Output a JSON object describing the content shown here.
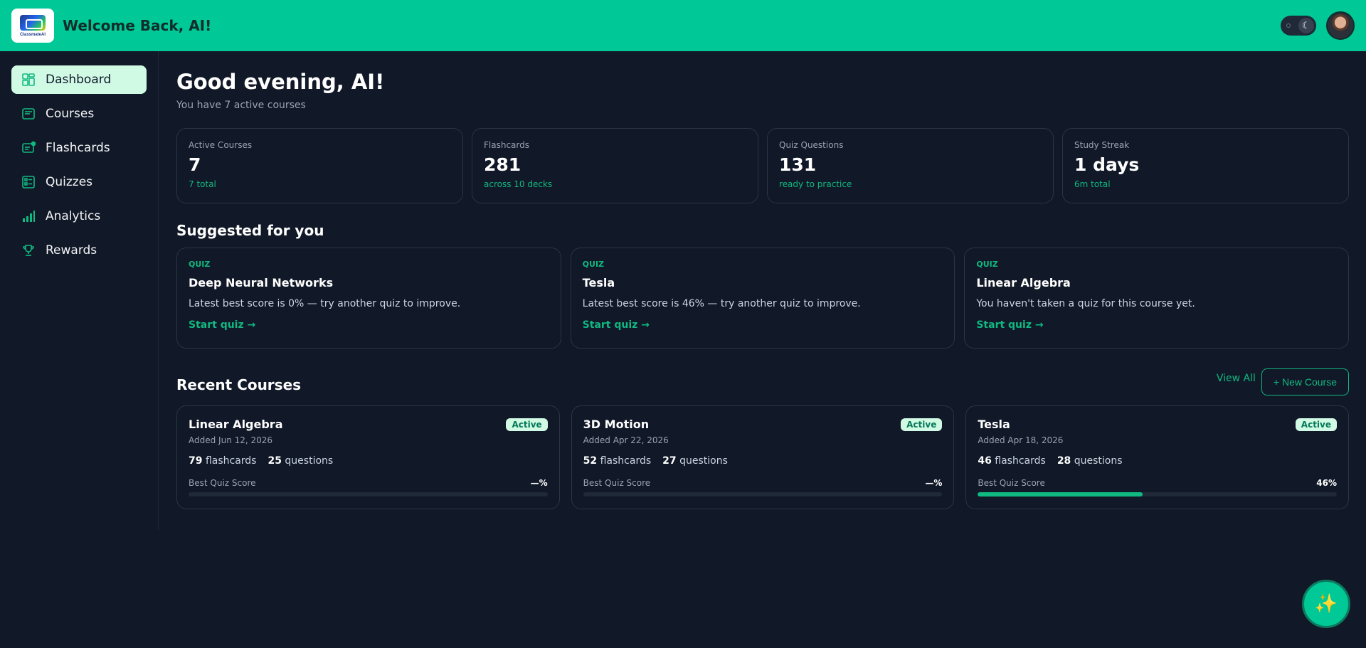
{
  "header": {
    "logo_text": "ClassmateAI",
    "title": "Welcome Back, AI!",
    "theme_toggle_icon": "moon-icon",
    "avatar": "user-avatar"
  },
  "sidebar": {
    "items": [
      {
        "label": "Dashboard",
        "icon": "dashboard-icon",
        "active": true
      },
      {
        "label": "Courses",
        "icon": "courses-icon"
      },
      {
        "label": "Flashcards",
        "icon": "flashcards-icon"
      },
      {
        "label": "Quizzes",
        "icon": "quizzes-icon"
      },
      {
        "label": "Analytics",
        "icon": "analytics-icon"
      },
      {
        "label": "Rewards",
        "icon": "trophy-icon"
      }
    ]
  },
  "main": {
    "greeting": "Good evening, AI!",
    "subgreeting": "You have 7 active courses",
    "stats": [
      {
        "label": "Active Courses",
        "value": "7",
        "sub": "7 total"
      },
      {
        "label": "Flashcards",
        "value": "281",
        "sub": "across 10 decks"
      },
      {
        "label": "Quiz Questions",
        "value": "131",
        "sub": "ready to practice"
      },
      {
        "label": "Study Streak",
        "value": "1 days",
        "sub": "6m total"
      }
    ],
    "suggested_title": "Suggested for you",
    "suggested": [
      {
        "kind": "QUIZ",
        "name": "Deep Neural Networks",
        "desc": "Latest best score is 0% — try another quiz to improve.",
        "cta": "Start quiz →"
      },
      {
        "kind": "QUIZ",
        "name": "Tesla",
        "desc": "Latest best score is 46% — try another quiz to improve.",
        "cta": "Start quiz →"
      },
      {
        "kind": "QUIZ",
        "name": "Linear Algebra",
        "desc": "You haven't taken a quiz for this course yet.",
        "cta": "Start quiz →"
      }
    ],
    "recent_title": "Recent Courses",
    "view_all": "View All",
    "new_course": "+ New Course",
    "courses": [
      {
        "name": "Linear Algebra",
        "badge": "Active",
        "added": "Added Jun 12, 2026",
        "flashcards": "79",
        "flashcards_label": "flashcards",
        "questions": "25",
        "questions_label": "questions",
        "score_label": "Best Quiz Score",
        "score": "—%",
        "score_fraction": 0
      },
      {
        "name": "3D Motion",
        "badge": "Active",
        "added": "Added Apr 22, 2026",
        "flashcards": "52",
        "flashcards_label": "flashcards",
        "questions": "27",
        "questions_label": "questions",
        "score_label": "Best Quiz Score",
        "score": "—%",
        "score_fraction": 0
      },
      {
        "name": "Tesla",
        "badge": "Active",
        "added": "Added Apr 18, 2026",
        "flashcards": "46",
        "flashcards_label": "flashcards",
        "questions": "28",
        "questions_label": "questions",
        "score_label": "Best Quiz Score",
        "score": "46%",
        "score_fraction": 0.46
      }
    ]
  },
  "fab": {
    "icon": "sparkles-icon",
    "glyph": "✨"
  },
  "colors": {
    "accent": "#00c896",
    "background": "#111827",
    "active_nav": "#d1fae5",
    "success_text": "#10b981"
  }
}
